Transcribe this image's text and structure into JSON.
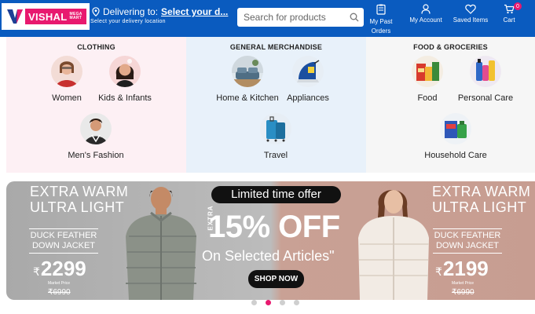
{
  "header": {
    "logo_text": "VISHAL",
    "logo_sub": "MEGA MART",
    "deliver_label": "Delivering to:",
    "deliver_select": "Select your d...",
    "deliver_sub": "Select your delivery location",
    "search_placeholder": "Search for products",
    "nav": {
      "past_orders": "My Past Orders",
      "account": "My Account",
      "saved": "Saved Items",
      "cart": "Cart",
      "cart_count": "0"
    }
  },
  "categories": {
    "clothing": {
      "title": "CLOTHING",
      "items": [
        "Women",
        "Kids & Infants",
        "Men's Fashion"
      ]
    },
    "general": {
      "title": "GENERAL MERCHANDISE",
      "items": [
        "Home & Kitchen",
        "Appliances",
        "Travel"
      ]
    },
    "food": {
      "title": "FOOD & GROCERIES",
      "items": [
        "Food",
        "Personal Care",
        "Household Care"
      ]
    }
  },
  "banner": {
    "left_title": "EXTRA WARM ULTRA LIGHT",
    "left_title_1": "EXTRA WARM",
    "left_title_2": "ULTRA LIGHT",
    "left_sub_1": "DUCK FEATHER",
    "left_sub_2": "DOWN JACKET",
    "left_price": "2299",
    "left_mp_label": "Market Price",
    "left_mp": "6990",
    "offer": "Limited time offer",
    "extra": "EXTRA",
    "percent": "15% OFF",
    "selected": "On Selected Articles\"",
    "shop": "SHOP NOW",
    "right_title_1": "EXTRA WARM",
    "right_title_2": "ULTRA LIGHT",
    "right_sub_1": "DUCK FEATHER",
    "right_sub_2": "DOWN JACKET",
    "right_price": "2199",
    "right_mp_label": "Market Price",
    "right_mp": "6990",
    "rupee": "₹"
  },
  "carousel": {
    "count": 4,
    "active": 2
  },
  "colors": {
    "header_bg": "#0a5bbf",
    "brand_pink": "#e8196f",
    "clothing_bg": "#fdf0f4",
    "general_bg": "#e8f1fa",
    "food_bg": "#f6f6f6"
  }
}
